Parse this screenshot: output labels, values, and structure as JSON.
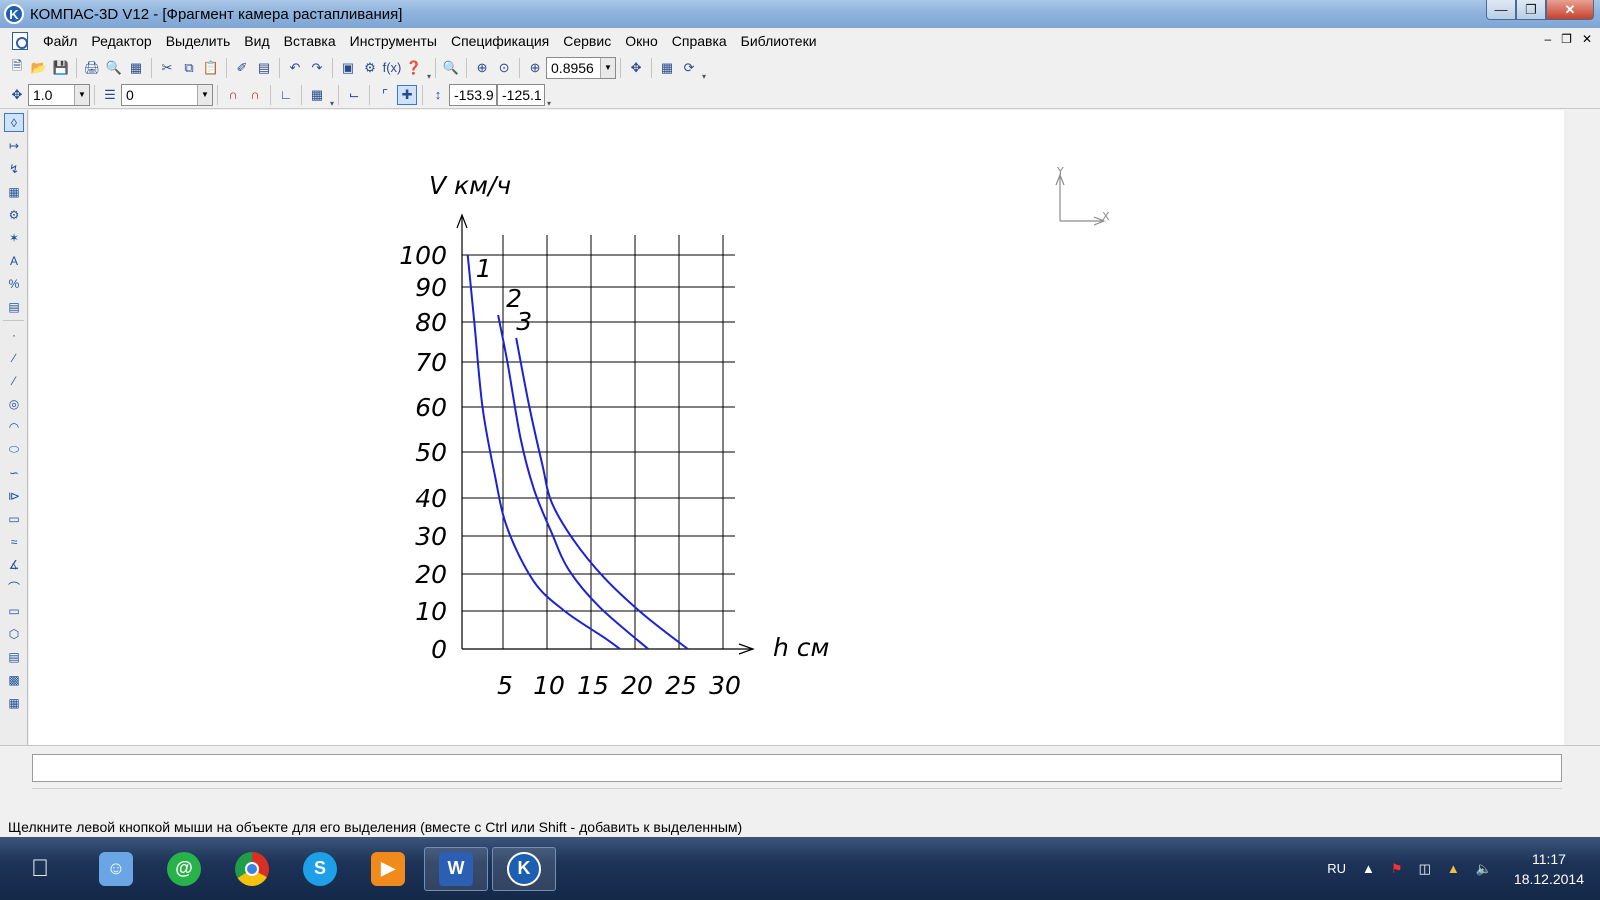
{
  "window": {
    "title": "КОМПАС-3D V12 - [Фрагмент камера растапливания]"
  },
  "menu": [
    "Файл",
    "Редактор",
    "Выделить",
    "Вид",
    "Вставка",
    "Инструменты",
    "Спецификация",
    "Сервис",
    "Окно",
    "Справка",
    "Библиотеки"
  ],
  "toolbar": {
    "zoom_value": "0.8956"
  },
  "toolbar2": {
    "step_value": "1.0",
    "layer_value": "0",
    "coord_x": "-153.9",
    "coord_y": "-125.1"
  },
  "drawing": {
    "y_axis_label": "V км/ч",
    "x_axis_label": "h см",
    "y_ticks": [
      "100",
      "90",
      "80",
      "70",
      "60",
      "50",
      "40",
      "30",
      "20",
      "10",
      "0"
    ],
    "x_ticks": [
      "5",
      "10",
      "15",
      "20",
      "25",
      "30"
    ],
    "curve_labels": [
      "1",
      "2",
      "3"
    ],
    "origin_y_label": "Y",
    "origin_x_label": "X",
    "curve_color": "#1a22d6"
  },
  "chart_data": {
    "type": "line",
    "xlabel": "h см",
    "ylabel": "V км/ч",
    "xlim": [
      0,
      30
    ],
    "ylim": [
      0,
      100
    ],
    "series": [
      {
        "name": "1",
        "x": [
          0.7,
          1.5,
          2.5,
          4.0,
          5.5,
          8.5,
          12.0,
          16.5,
          18.3
        ],
        "y": [
          100,
          80,
          60,
          45,
          32,
          18,
          10,
          3,
          0
        ]
      },
      {
        "name": "2",
        "x": [
          4.4,
          5.5,
          7.0,
          8.5,
          10.5,
          12.5,
          16.0,
          21.5
        ],
        "y": [
          82,
          70,
          53,
          42,
          31,
          21,
          11,
          0
        ]
      },
      {
        "name": "3",
        "x": [
          6.5,
          8.0,
          9.5,
          10.5,
          13.0,
          16.5,
          21.0,
          26.0
        ],
        "y": [
          76,
          60,
          47,
          39,
          29,
          19,
          9,
          0
        ]
      }
    ]
  },
  "status": {
    "hint": "Щелкните левой кнопкой мыши на объекте для его выделения (вместе с Ctrl или Shift - добавить к выделенным)"
  },
  "taskbar": {
    "lang": "RU",
    "time": "11:17",
    "date": "18.12.2014"
  }
}
